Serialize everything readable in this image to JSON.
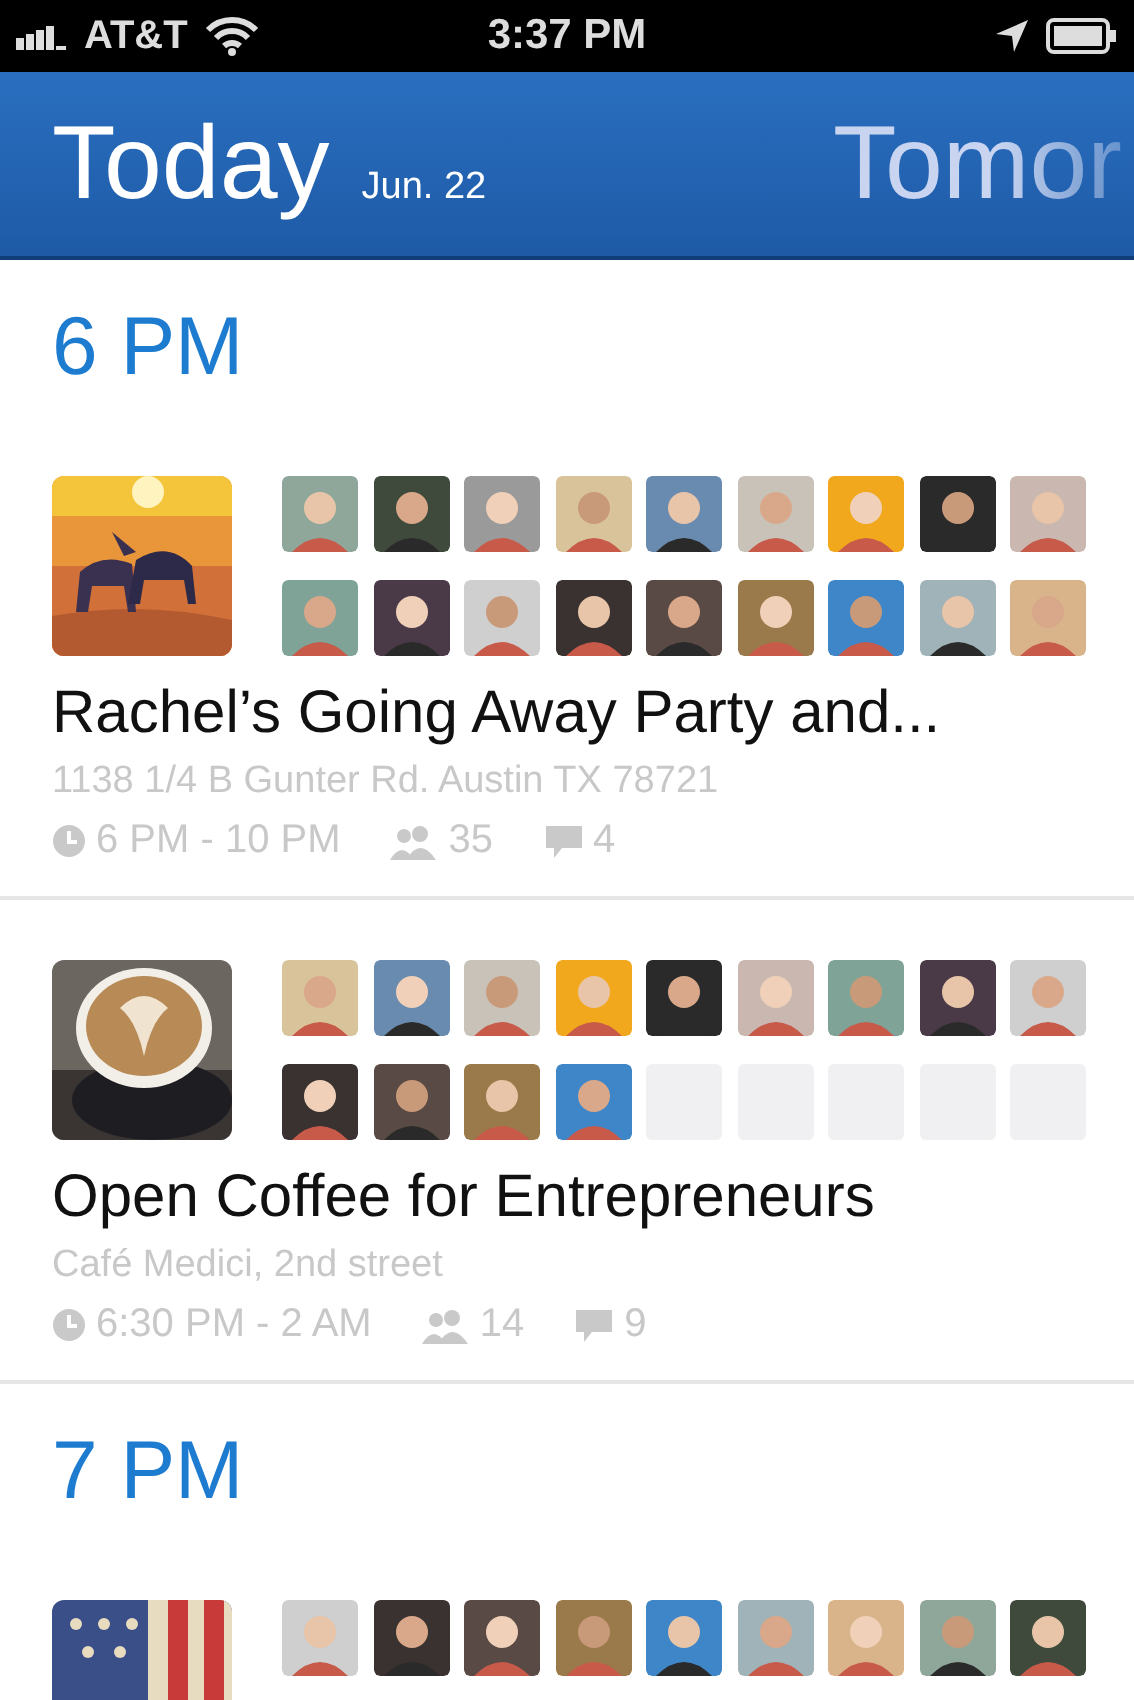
{
  "status_bar": {
    "carrier": "AT&T",
    "time": "3:37 PM"
  },
  "header": {
    "days": [
      {
        "label": "Today",
        "date": "Jun. 22",
        "selected": true
      },
      {
        "label": "Tomor",
        "selected": false
      }
    ]
  },
  "sections": [
    {
      "heading": "6 PM",
      "events": [
        {
          "image": {
            "kind": "picture"
          },
          "attendees": [
            {
              "kind": "picture"
            },
            {
              "kind": "picture"
            },
            {
              "kind": "picture"
            },
            {
              "kind": "picture"
            },
            {
              "kind": "picture"
            },
            {
              "kind": "picture"
            },
            {
              "kind": "picture"
            },
            {
              "kind": "picture"
            },
            {
              "kind": "picture"
            },
            {
              "kind": "picture"
            },
            {
              "kind": "picture"
            },
            {
              "kind": "picture"
            },
            {
              "kind": "picture"
            },
            {
              "kind": "picture"
            },
            {
              "kind": "picture"
            },
            {
              "kind": "picture"
            },
            {
              "kind": "picture"
            },
            {
              "kind": "picture"
            }
          ],
          "title": "Rachel’s Going Away Party and...",
          "location": "1138 1/4 B Gunter Rd. Austin TX 78721",
          "time": "6 PM - 10 PM",
          "people": "35",
          "comments": "4"
        },
        {
          "image": {
            "kind": "picture"
          },
          "attendees": [
            {
              "kind": "picture"
            },
            {
              "kind": "picture"
            },
            {
              "kind": "picture"
            },
            {
              "kind": "picture"
            },
            {
              "kind": "picture"
            },
            {
              "kind": "picture"
            },
            {
              "kind": "picture"
            },
            {
              "kind": "picture"
            },
            {
              "kind": "picture"
            },
            {
              "kind": "picture"
            },
            {
              "kind": "picture"
            },
            {
              "kind": "picture"
            },
            {
              "kind": "picture"
            },
            {
              "kind": "empty"
            },
            {
              "kind": "empty"
            },
            {
              "kind": "empty"
            },
            {
              "kind": "empty"
            },
            {
              "kind": "empty"
            }
          ],
          "title": "Open Coffee for Entrepreneurs",
          "location": "Café Medici, 2nd street",
          "time": "6:30 PM - 2 AM",
          "people": "14",
          "comments": "9"
        }
      ]
    },
    {
      "heading": "7 PM",
      "events": [
        {
          "image": {
            "kind": "picture"
          },
          "attendees": [
            {
              "kind": "picture"
            },
            {
              "kind": "picture"
            },
            {
              "kind": "picture"
            },
            {
              "kind": "picture"
            },
            {
              "kind": "picture"
            },
            {
              "kind": "picture"
            },
            {
              "kind": "picture"
            },
            {
              "kind": "picture"
            },
            {
              "kind": "picture"
            }
          ]
        }
      ]
    }
  ]
}
